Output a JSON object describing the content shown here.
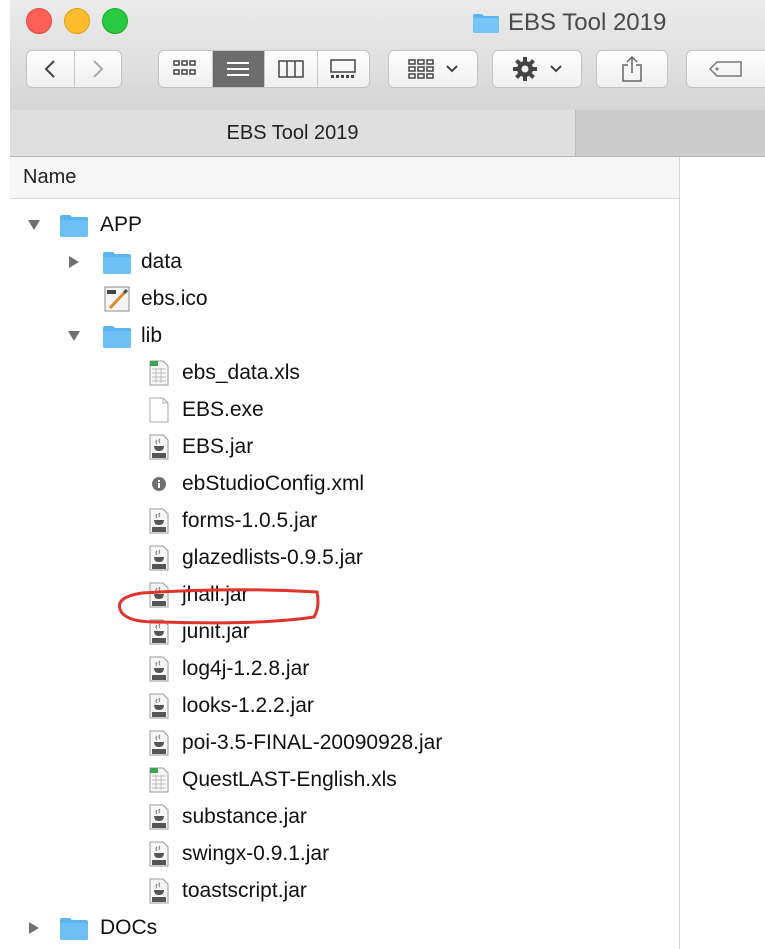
{
  "window": {
    "title": "EBS Tool 2019"
  },
  "toolbar": {
    "back_icon": "chevron-left-icon",
    "forward_icon": "chevron-right-icon",
    "view_modes": [
      "icon-view-icon",
      "list-view-icon",
      "column-view-icon",
      "gallery-view-icon"
    ],
    "active_view": "list-view-icon",
    "group_icon": "group-icon",
    "action_icon": "gear-icon",
    "share_icon": "share-icon",
    "tag_icon": "tag-icon"
  },
  "tabbar": {
    "active_tab": "EBS Tool 2019"
  },
  "columns": {
    "name": "Name"
  },
  "rows": [
    {
      "name": "APP",
      "kind": "folder",
      "level": 0,
      "disclosure": "expanded"
    },
    {
      "name": "data",
      "kind": "folder",
      "level": 1,
      "disclosure": "collapsed"
    },
    {
      "name": "ebs.ico",
      "kind": "ico",
      "level": 1,
      "disclosure": "none"
    },
    {
      "name": "lib",
      "kind": "folder",
      "level": 1,
      "disclosure": "expanded"
    },
    {
      "name": "ebs_data.xls",
      "kind": "xls",
      "level": 2,
      "disclosure": "none"
    },
    {
      "name": "EBS.exe",
      "kind": "exe",
      "level": 2,
      "disclosure": "none"
    },
    {
      "name": "EBS.jar",
      "kind": "jar",
      "level": 2,
      "disclosure": "none",
      "highlighted": true
    },
    {
      "name": "ebStudioConfig.xml",
      "kind": "xml",
      "level": 2,
      "disclosure": "none"
    },
    {
      "name": "forms-1.0.5.jar",
      "kind": "jar",
      "level": 2,
      "disclosure": "none"
    },
    {
      "name": "glazedlists-0.9.5.jar",
      "kind": "jar",
      "level": 2,
      "disclosure": "none"
    },
    {
      "name": "jhall.jar",
      "kind": "jar",
      "level": 2,
      "disclosure": "none"
    },
    {
      "name": "junit.jar",
      "kind": "jar",
      "level": 2,
      "disclosure": "none"
    },
    {
      "name": "log4j-1.2.8.jar",
      "kind": "jar",
      "level": 2,
      "disclosure": "none"
    },
    {
      "name": "looks-1.2.2.jar",
      "kind": "jar",
      "level": 2,
      "disclosure": "none"
    },
    {
      "name": "poi-3.5-FINAL-20090928.jar",
      "kind": "jar",
      "level": 2,
      "disclosure": "none"
    },
    {
      "name": "QuestLAST-English.xls",
      "kind": "xls",
      "level": 2,
      "disclosure": "none"
    },
    {
      "name": "substance.jar",
      "kind": "jar",
      "level": 2,
      "disclosure": "none"
    },
    {
      "name": "swingx-0.9.1.jar",
      "kind": "jar",
      "level": 2,
      "disclosure": "none"
    },
    {
      "name": "toastscript.jar",
      "kind": "jar",
      "level": 2,
      "disclosure": "none"
    },
    {
      "name": "DOCs",
      "kind": "folder",
      "level": 0,
      "disclosure": "collapsed"
    }
  ],
  "annotation": {
    "color": "#e0332a",
    "target": "EBS.jar"
  },
  "colors": {
    "folder": "#6cc0f5",
    "active_view_bg": "#6c6c6c"
  }
}
